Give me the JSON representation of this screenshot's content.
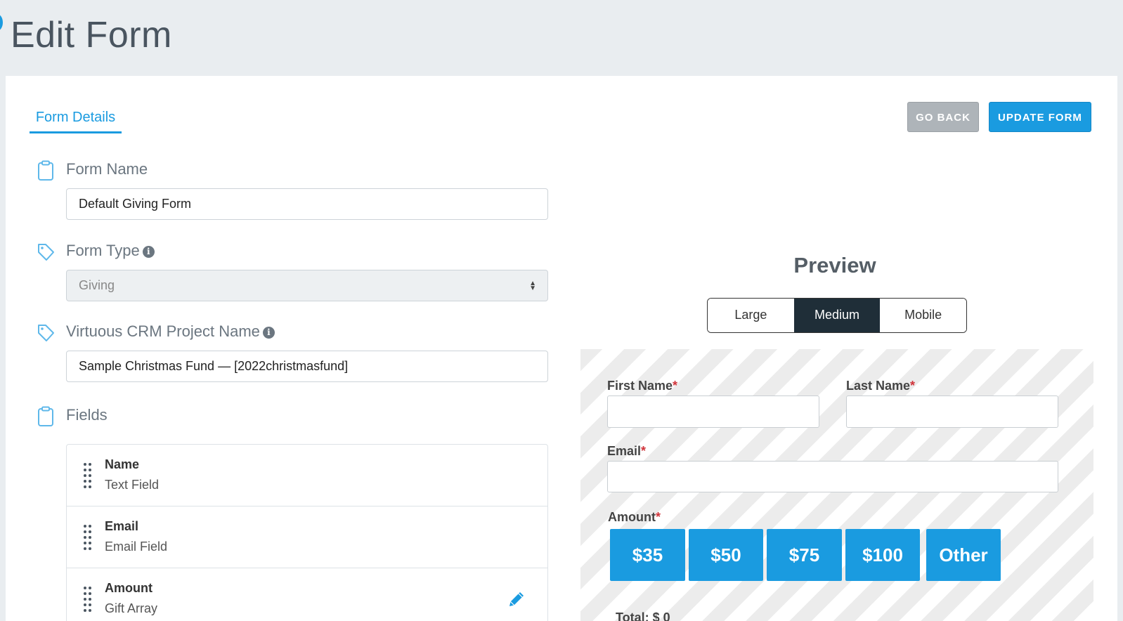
{
  "page": {
    "title": "Edit Form"
  },
  "tabs": [
    {
      "label": "Form Details",
      "active": true
    }
  ],
  "actions": {
    "go_back": "GO BACK",
    "update_form": "UPDATE FORM"
  },
  "form": {
    "form_name": {
      "label": "Form Name",
      "value": "Default Giving Form",
      "icon": "clipboard-icon"
    },
    "form_type": {
      "label": "Form Type",
      "value": "Giving",
      "icon": "tag-icon",
      "info": "i"
    },
    "project_name": {
      "label": "Virtuous CRM Project Name",
      "value": "Sample Christmas Fund — [2022christmasfund]",
      "icon": "tag-icon",
      "info": "i"
    },
    "fields": {
      "label": "Fields",
      "icon": "clipboard-icon",
      "items": [
        {
          "name": "Name",
          "type": "Text Field",
          "editable": false
        },
        {
          "name": "Email",
          "type": "Email Field",
          "editable": false
        },
        {
          "name": "Amount",
          "type": "Gift Array",
          "editable": true
        }
      ]
    }
  },
  "preview": {
    "title": "Preview",
    "sizes": [
      {
        "label": "Large",
        "active": false
      },
      {
        "label": "Medium",
        "active": true
      },
      {
        "label": "Mobile",
        "active": false
      }
    ],
    "first_name_label": "First Name",
    "last_name_label": "Last Name",
    "email_label": "Email",
    "amount_label": "Amount",
    "required_mark": "*",
    "amounts": [
      "$35",
      "$50",
      "$75",
      "$100",
      "Other"
    ],
    "total": "Total: $ 0"
  },
  "colors": {
    "accent": "#1a9be0",
    "toggle_active": "#1f2e38",
    "go_back_bg": "#aeb4b9",
    "required": "#d0343a"
  }
}
